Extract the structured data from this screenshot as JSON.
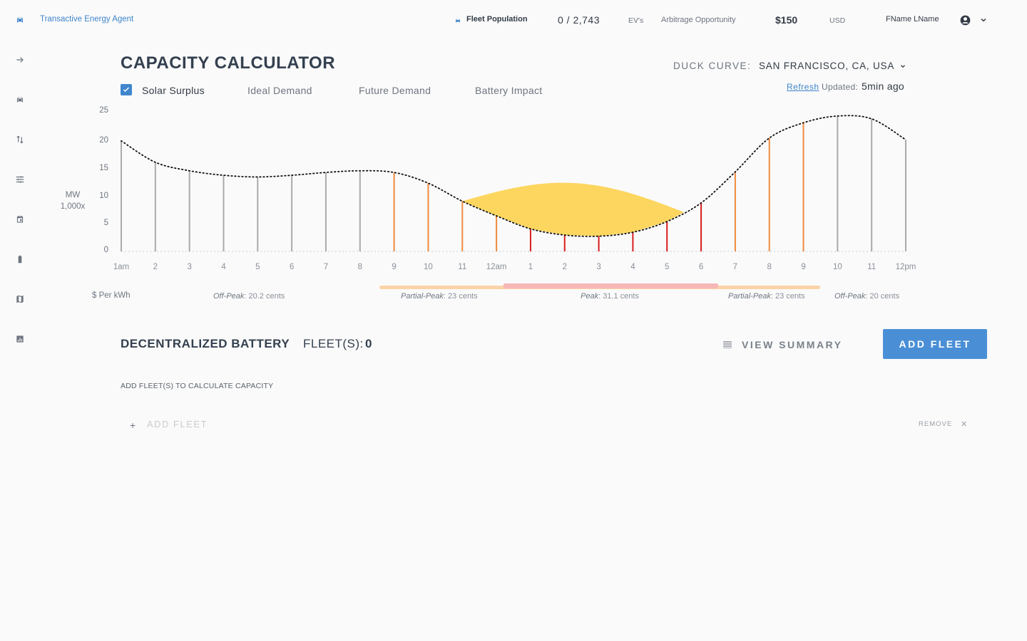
{
  "header": {
    "app_title": "Transactive Energy Agent",
    "fleet_population_label": "Fleet Population",
    "fleet_population_value": "0 / 2,743",
    "evs_label": "EV's",
    "arbitrage_label": "Arbitrage Opportunity",
    "arbitrage_value": "$150",
    "currency": "USD",
    "user_name": "FName LName"
  },
  "sidebar": {
    "items": [
      {
        "icon": "car-icon",
        "active": true
      },
      {
        "icon": "arrow-right-icon"
      },
      {
        "icon": "car-icon"
      },
      {
        "icon": "swap-vertical-icon"
      },
      {
        "icon": "sliders-icon"
      },
      {
        "icon": "calendar-icon"
      },
      {
        "icon": "battery-icon"
      },
      {
        "icon": "map-icon"
      },
      {
        "icon": "bar-chart-icon"
      }
    ]
  },
  "capacity": {
    "title": "CAPACITY CALCULATOR",
    "duck_curve_label": "DUCK CURVE:",
    "duck_curve_value": "SAN FRANCISCO, CA, USA",
    "refresh_label": "Refresh",
    "updated_label": "Updated:",
    "updated_value": "5min ago",
    "tabs": [
      {
        "label": "Solar Surplus",
        "checked": true
      },
      {
        "label": "Ideal Demand",
        "checked": false
      },
      {
        "label": "Future Demand",
        "checked": false
      },
      {
        "label": "Battery Impact",
        "checked": false
      }
    ]
  },
  "chart_data": {
    "type": "line",
    "ylabel_line1": "MW",
    "ylabel_line2": "1,000x",
    "yticks": [
      "0",
      "5",
      "10",
      "15",
      "20",
      "25"
    ],
    "ylim": [
      0,
      25
    ],
    "categories": [
      "1am",
      "2",
      "3",
      "4",
      "5",
      "6",
      "7",
      "8",
      "9",
      "10",
      "11",
      "12am",
      "1",
      "2",
      "3",
      "4",
      "5",
      "6",
      "7",
      "8",
      "9",
      "10",
      "11",
      "12pm"
    ],
    "values": [
      19.6,
      15.8,
      14.3,
      13.5,
      13.2,
      13.5,
      14.0,
      14.3,
      14.0,
      12.1,
      8.9,
      6.3,
      4.0,
      2.9,
      2.7,
      3.4,
      5.3,
      8.6,
      14.1,
      20.1,
      22.8,
      24.0,
      23.5,
      19.8
    ],
    "bar_colors": [
      "#aaaaaa",
      "#aaaaaa",
      "#aaaaaa",
      "#aaaaaa",
      "#aaaaaa",
      "#aaaaaa",
      "#aaaaaa",
      "#aaaaaa",
      "#f08a3e",
      "#f08a3e",
      "#f08a3e",
      "#f08a3e",
      "#d81e1e",
      "#d81e1e",
      "#d81e1e",
      "#d81e1e",
      "#d81e1e",
      "#d81e1e",
      "#f08a3e",
      "#f08a3e",
      "#f08a3e",
      "#aaaaaa",
      "#aaaaaa",
      "#aaaaaa"
    ],
    "solar_surplus_color": "#fdd24e",
    "rate_periods": [
      {
        "name": "Partial-Peak",
        "color": "#fbd3a8"
      },
      {
        "name": "Peak",
        "color": "#f7b7b7"
      },
      {
        "name": "Partial-Peak",
        "color": "#fbd3a8"
      }
    ]
  },
  "rates": {
    "title": "$ Per  kWh",
    "items": [
      {
        "name": "Off-Peak",
        "value": ": 20.2 cents"
      },
      {
        "name": "Partial-Peak",
        "value": ": 23 cents"
      },
      {
        "name": "Peak",
        "value": ": 31.1 cents"
      },
      {
        "name": "Partial-Peak",
        "value": ": 23 cents"
      },
      {
        "name": "Off-Peak",
        "value": ": 20 cents"
      }
    ]
  },
  "fleet": {
    "title": "DECENTRALIZED BATTERY",
    "fleets_label": "FLEET(S):",
    "fleets_count": "0",
    "view_summary": "VIEW SUMMARY",
    "add_fleet": "ADD FLEET",
    "hint": "ADD FLEET(S) TO CALCULATE CAPACITY",
    "add_row_placeholder": "ADD FLEET",
    "remove_label": "REMOVE"
  }
}
